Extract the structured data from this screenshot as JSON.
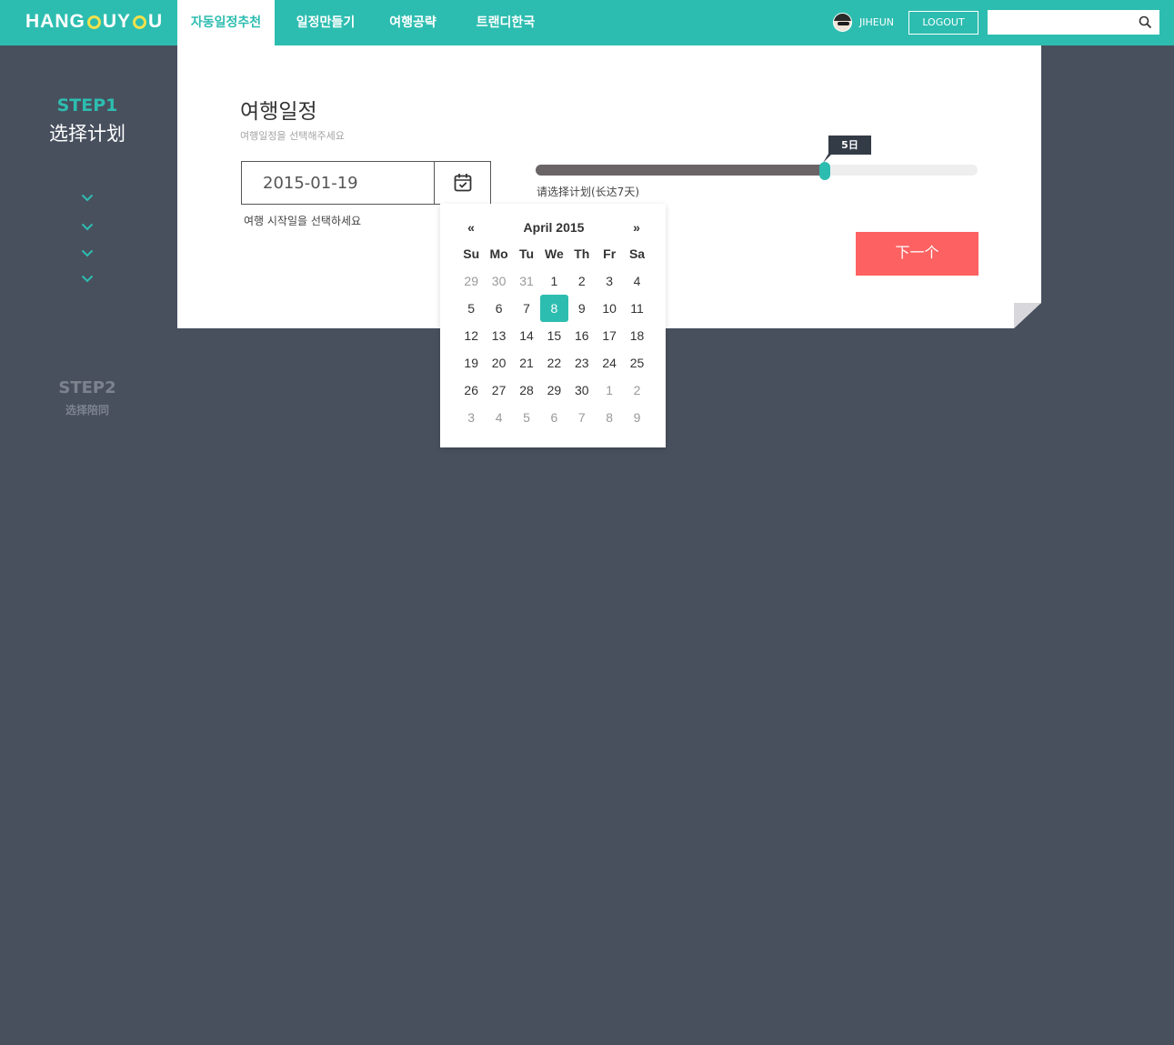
{
  "app": {
    "logo_text": "HANGOUYOU",
    "brand_color": "#2dbdb0"
  },
  "nav": {
    "items": [
      {
        "label": "자동일정추천"
      },
      {
        "label": "일정만들기"
      },
      {
        "label": "여행공략"
      },
      {
        "label": "트랜디한국"
      }
    ]
  },
  "user": {
    "name": "JIHEUN",
    "logout_label": "LOGOUT"
  },
  "search": {
    "value": "",
    "icon": "search-icon"
  },
  "steps": {
    "step1": {
      "label": "STEP1",
      "title": "选择计划"
    },
    "step2": {
      "label": "STEP2",
      "subtitle": "选择陪同"
    }
  },
  "form": {
    "title": "여행일정",
    "subtitle": "여행일정을 선택해주세요",
    "date_value": "2015-01-19",
    "date_hint": "여행 시작일을 선택하세요",
    "slider": {
      "tooltip": "5日",
      "caption": "请选择计划(长达7天)",
      "value_fraction": 0.655
    },
    "next_label": "下一个",
    "next_color": "#fd6161"
  },
  "calendar": {
    "prev": "«",
    "next": "»",
    "month_label": "April 2015",
    "weekdays": [
      "Su",
      "Mo",
      "Tu",
      "We",
      "Th",
      "Fr",
      "Sa"
    ],
    "days": [
      {
        "d": "29",
        "m": true
      },
      {
        "d": "30",
        "m": true
      },
      {
        "d": "31",
        "m": true
      },
      {
        "d": "1"
      },
      {
        "d": "2"
      },
      {
        "d": "3"
      },
      {
        "d": "4"
      },
      {
        "d": "5"
      },
      {
        "d": "6"
      },
      {
        "d": "7"
      },
      {
        "d": "8",
        "sel": true
      },
      {
        "d": "9"
      },
      {
        "d": "10"
      },
      {
        "d": "11"
      },
      {
        "d": "12"
      },
      {
        "d": "13"
      },
      {
        "d": "14"
      },
      {
        "d": "15"
      },
      {
        "d": "16"
      },
      {
        "d": "17"
      },
      {
        "d": "18"
      },
      {
        "d": "19"
      },
      {
        "d": "20"
      },
      {
        "d": "21"
      },
      {
        "d": "22"
      },
      {
        "d": "23"
      },
      {
        "d": "24"
      },
      {
        "d": "25"
      },
      {
        "d": "26"
      },
      {
        "d": "27"
      },
      {
        "d": "28"
      },
      {
        "d": "29"
      },
      {
        "d": "30"
      },
      {
        "d": "1",
        "m": true
      },
      {
        "d": "2",
        "m": true
      },
      {
        "d": "3",
        "m": true
      },
      {
        "d": "4",
        "m": true
      },
      {
        "d": "5",
        "m": true
      },
      {
        "d": "6",
        "m": true
      },
      {
        "d": "7",
        "m": true
      },
      {
        "d": "8",
        "m": true
      },
      {
        "d": "9",
        "m": true
      }
    ]
  }
}
